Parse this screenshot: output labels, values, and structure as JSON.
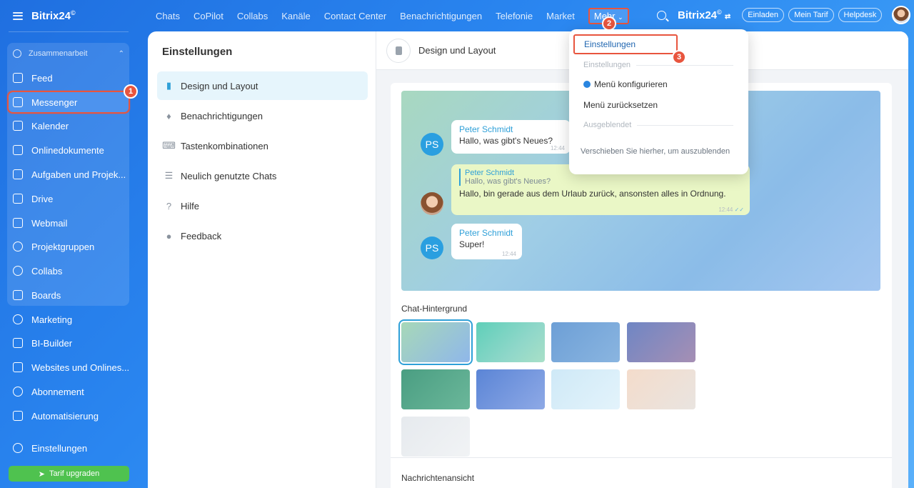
{
  "sidebar": {
    "brand": "Bitrix24",
    "brand_mark": "©",
    "group_label": "Zusammenarbeit",
    "items": [
      {
        "label": "Feed",
        "icon": "feed-icon"
      },
      {
        "label": "Messenger",
        "icon": "messenger-icon",
        "active": true
      },
      {
        "label": "Kalender",
        "icon": "calendar-icon"
      },
      {
        "label": "Onlinedokumente",
        "icon": "document-icon"
      },
      {
        "label": "Aufgaben und Projek...",
        "icon": "tasks-icon"
      },
      {
        "label": "Drive",
        "icon": "drive-icon"
      },
      {
        "label": "Webmail",
        "icon": "mail-icon"
      },
      {
        "label": "Projektgruppen",
        "icon": "groups-icon"
      },
      {
        "label": "Collabs",
        "icon": "collabs-icon"
      },
      {
        "label": "Boards",
        "icon": "boards-icon"
      },
      {
        "label": "Marketing",
        "icon": "marketing-icon"
      },
      {
        "label": "BI-Builder",
        "icon": "bi-builder-icon"
      },
      {
        "label": "Websites und Onlines...",
        "icon": "cart-icon"
      },
      {
        "label": "Abonnement",
        "icon": "subscription-icon"
      },
      {
        "label": "Automatisierung",
        "icon": "automation-icon"
      }
    ],
    "settings_label": "Einstellungen",
    "upgrade_label": "Tarif upgraden"
  },
  "topnav": {
    "items": [
      "Chats",
      "CoPilot",
      "Collabs",
      "Kanäle",
      "Contact Center",
      "Benachrichtigungen",
      "Telefonie",
      "Market"
    ],
    "more_label": "Mehr",
    "brand": "Bitrix24",
    "invite_label": "Einladen",
    "plan_label": "Mein Tarif",
    "helpdesk_label": "Helpdesk"
  },
  "dropdown": {
    "settings_item": "Einstellungen",
    "section_settings": "Einstellungen",
    "configure_item": "Menü konfigurieren",
    "reset_item": "Menü zurücksetzen",
    "section_hidden": "Ausgeblendet",
    "hint": "Verschieben Sie hierher, um auszublenden"
  },
  "steps": [
    "1",
    "2",
    "3"
  ],
  "settings_panel": {
    "title": "Einstellungen",
    "items": [
      {
        "label": "Design und Layout",
        "icon": "brush-icon",
        "selected": true
      },
      {
        "label": "Benachrichtigungen",
        "icon": "bell-icon"
      },
      {
        "label": "Tastenkombinationen",
        "icon": "keyboard-icon"
      },
      {
        "label": "Neulich genutzte Chats",
        "icon": "list-icon"
      },
      {
        "label": "Hilfe",
        "icon": "help-icon"
      },
      {
        "label": "Feedback",
        "icon": "feedback-icon"
      }
    ]
  },
  "design": {
    "header": "Design und Layout",
    "messages": [
      {
        "author": "Peter Schmidt",
        "text": "Hallo, was gibt's Neues?",
        "time": "12:44",
        "initials": "PS"
      },
      {
        "quote_author": "Peter Schmidt",
        "quote_text": "Hallo, was gibt's Neues?",
        "text": "Hallo, bin gerade aus dem Urlaub zurück, ansonsten alles in Ordnung.",
        "time": "12:44"
      },
      {
        "author": "Peter Schmidt",
        "text": "Super!",
        "time": "12:44",
        "initials": "PS"
      }
    ],
    "background_title": "Chat-Hintergrund",
    "next_section_title": "Nachrichtenansicht",
    "swatches": [
      "linear-gradient(135deg,#a7d8b8,#8fb7ea)",
      "linear-gradient(135deg,#5fcfb9,#8fd7c9 60%,#a9e0c8)",
      "linear-gradient(135deg,#6d9fd6,#8ab5e0)",
      "linear-gradient(135deg,#6f86c4,#a68fb4)",
      "linear-gradient(135deg,#4a9e82,#6bb79a)",
      "linear-gradient(135deg,#5b85d6,#8ea9e6)",
      "linear-gradient(135deg,#cfe9f7,#e3f3fb)",
      "linear-gradient(135deg,#f4dccb,#e9e4e0)",
      "linear-gradient(135deg,#e6eaee,#f1f3f5)"
    ]
  },
  "colors": {
    "accent": "#2fa0d8",
    "highlight": "#e8553e",
    "upgrade": "#4fc24f"
  }
}
